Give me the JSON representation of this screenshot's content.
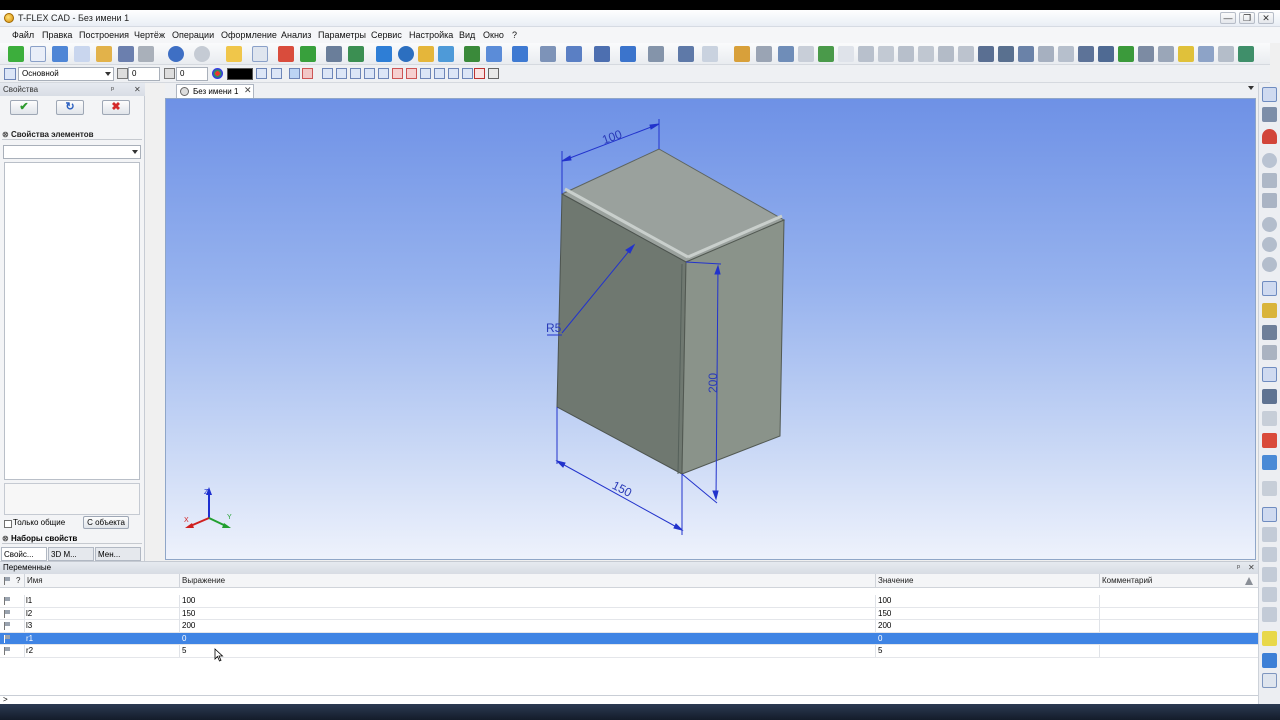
{
  "window": {
    "title": "T-FLEX CAD - Без имени 1",
    "buttons": [
      "—",
      "❐",
      "✕"
    ]
  },
  "menu": [
    "Файл",
    "Правка",
    "Построения",
    "Чертёж",
    "Операции",
    "Оформление",
    "Анализ",
    "Параметры",
    "Сервис",
    "Настройка",
    "Вид",
    "Окно",
    "?"
  ],
  "toolbar2": {
    "layer_value": "Основной",
    "level_value": "0",
    "priority_value": "0",
    "color_value": "#000000"
  },
  "properties_panel": {
    "title": "Свойства",
    "pin": "ᵖ",
    "close": "✕",
    "ok_label": "✔",
    "refresh_label": "↻",
    "cancel_label": "✖",
    "elements_section": "Свойства элементов",
    "only_common_label": "Только общие",
    "from_object_label": "С объекта",
    "property_sets_section": "Наборы свойств",
    "tabs": [
      "Свойс...",
      "3D М...",
      "Мен..."
    ]
  },
  "document": {
    "tab_label": "Без имени 1",
    "close": "✕"
  },
  "model": {
    "dim_width": "100",
    "dim_depth": "150",
    "dim_height": "200",
    "dim_radius": "R5",
    "axis_x": "X",
    "axis_y": "Y",
    "axis_z": "Z"
  },
  "variables_panel": {
    "title": "Переменные",
    "pin": "ᵖ",
    "close": "✕",
    "columns": {
      "q": "?",
      "name": "Имя",
      "expression": "Выражение",
      "value": "Значение",
      "comment": "Комментарий"
    },
    "rows": [
      {
        "name": "l1",
        "expression": "100",
        "value": "100",
        "comment": ""
      },
      {
        "name": "l2",
        "expression": "150",
        "value": "150",
        "comment": ""
      },
      {
        "name": "l3",
        "expression": "200",
        "value": "200",
        "comment": ""
      },
      {
        "name": "r1",
        "expression": "0",
        "value": "0",
        "comment": "",
        "selected": true
      },
      {
        "name": "r2",
        "expression": "5",
        "value": "5",
        "comment": ""
      }
    ]
  },
  "command_line": {
    "prompt": ">"
  },
  "colors": {
    "selection": "#3f84e4",
    "viewport_top": "#6e91e6",
    "dimension": "#2233cc",
    "box_front": "#6f7870",
    "box_side": "#8a938a",
    "box_top": "#9aa19d"
  }
}
